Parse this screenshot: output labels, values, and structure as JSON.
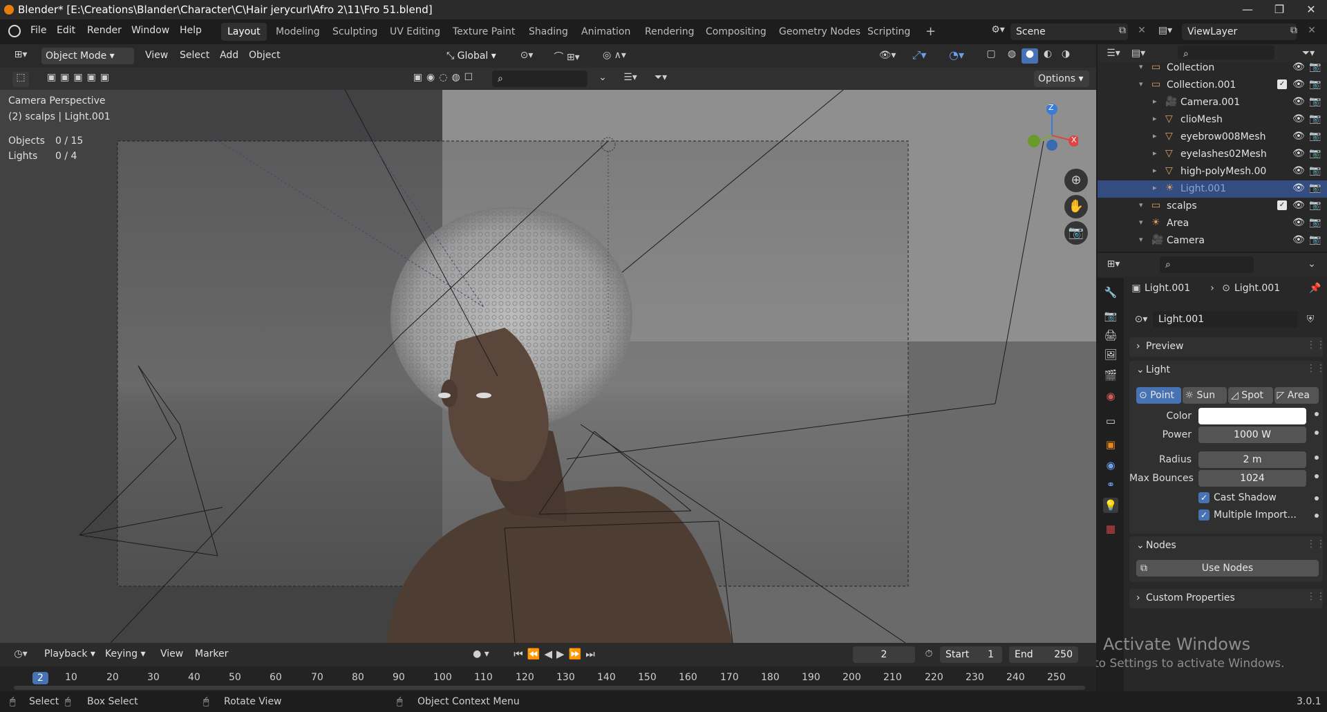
{
  "window": {
    "title": "Blender* [E:\\Creations\\Blander\\Character\\C\\Hair jerycurl\\Afro 2\\11\\Fro 51.blend]",
    "minimize": "—",
    "maximize": "❐",
    "close": "✕"
  },
  "menu": {
    "items": [
      "File",
      "Edit",
      "Render",
      "Window",
      "Help"
    ],
    "workspaces": [
      "Layout",
      "Modeling",
      "Sculpting",
      "UV Editing",
      "Texture Paint",
      "Shading",
      "Animation",
      "Rendering",
      "Compositing",
      "Geometry Nodes",
      "Scripting"
    ],
    "add_workspace": "+",
    "scene": "Scene",
    "view_layer": "ViewLayer"
  },
  "viewport": {
    "mode": "Object Mode",
    "menus": [
      "View",
      "Select",
      "Add",
      "Object"
    ],
    "orientation": "Global",
    "options": "Options",
    "overlay_title": "Camera Perspective",
    "overlay_subtitle": "(2) scalps | Light.001",
    "stats": [
      {
        "label": "Objects",
        "value": "0 / 15"
      },
      {
        "label": "Lights",
        "value": "0 / 4"
      }
    ],
    "gizmo": {
      "z": "Z",
      "x": "X"
    }
  },
  "outliner": {
    "rows": [
      {
        "name": "Collection",
        "depth": 1,
        "icon": "collection-icon",
        "check": false
      },
      {
        "name": "Collection.001",
        "depth": 1,
        "icon": "collection-icon",
        "check": true
      },
      {
        "name": "Camera.001",
        "depth": 2,
        "icon": "camera-icon",
        "check": false
      },
      {
        "name": "clioMesh",
        "depth": 2,
        "icon": "mesh-icon",
        "check": false
      },
      {
        "name": "eyebrow008Mesh",
        "depth": 2,
        "icon": "mesh-icon",
        "check": false
      },
      {
        "name": "eyelashes02Mesh",
        "depth": 2,
        "icon": "mesh-icon",
        "check": false
      },
      {
        "name": "high-polyMesh.00",
        "depth": 2,
        "icon": "mesh-icon",
        "check": false
      },
      {
        "name": "Light.001",
        "depth": 2,
        "icon": "light-icon",
        "check": false,
        "selected": true
      },
      {
        "name": "scalps",
        "depth": 1,
        "icon": "collection-icon",
        "check": true
      },
      {
        "name": "Area",
        "depth": 1,
        "icon": "light-icon",
        "check": false
      },
      {
        "name": "Camera",
        "depth": 1,
        "icon": "camera-icon",
        "check": false
      }
    ]
  },
  "properties": {
    "breadcrumb_object": "Light.001",
    "breadcrumb_data": "Light.001",
    "datablock": "Light.001",
    "preview_label": "Preview",
    "light_label": "Light",
    "light_types": [
      "Point",
      "Sun",
      "Spot",
      "Area"
    ],
    "active_light_type": "Point",
    "fields": [
      {
        "label": "Color",
        "value": ""
      },
      {
        "label": "Power",
        "value": "1000 W"
      },
      {
        "label": "Radius",
        "value": "2 m"
      },
      {
        "label": "Max Bounces",
        "value": "1024"
      }
    ],
    "checks": [
      "Cast Shadow",
      "Multiple Import..."
    ],
    "nodes_label": "Nodes",
    "use_nodes": "Use Nodes",
    "custom_props": "Custom Properties",
    "color_value": "#ffffff"
  },
  "timeline": {
    "menus": [
      "Playback",
      "Keying",
      "View",
      "Marker"
    ],
    "current_frame": "2",
    "start_label": "Start",
    "start": "1",
    "end_label": "End",
    "end": "250",
    "ruler": [
      "2",
      "10",
      "20",
      "30",
      "40",
      "50",
      "60",
      "70",
      "80",
      "90",
      "100",
      "110",
      "120",
      "130",
      "140",
      "150",
      "160",
      "170",
      "180",
      "190",
      "200",
      "210",
      "220",
      "230",
      "240",
      "250"
    ]
  },
  "status": {
    "select": "Select",
    "box_select": "Box Select",
    "rotate": "Rotate View",
    "context_menu": "Object Context Menu",
    "version": "3.0.1"
  },
  "watermark": {
    "title": "Activate Windows",
    "subtitle": "Go to Settings to activate Windows."
  },
  "colors": {
    "accent": "#4772b3",
    "selection": "#334d80",
    "bg": "#1d1d1d"
  }
}
